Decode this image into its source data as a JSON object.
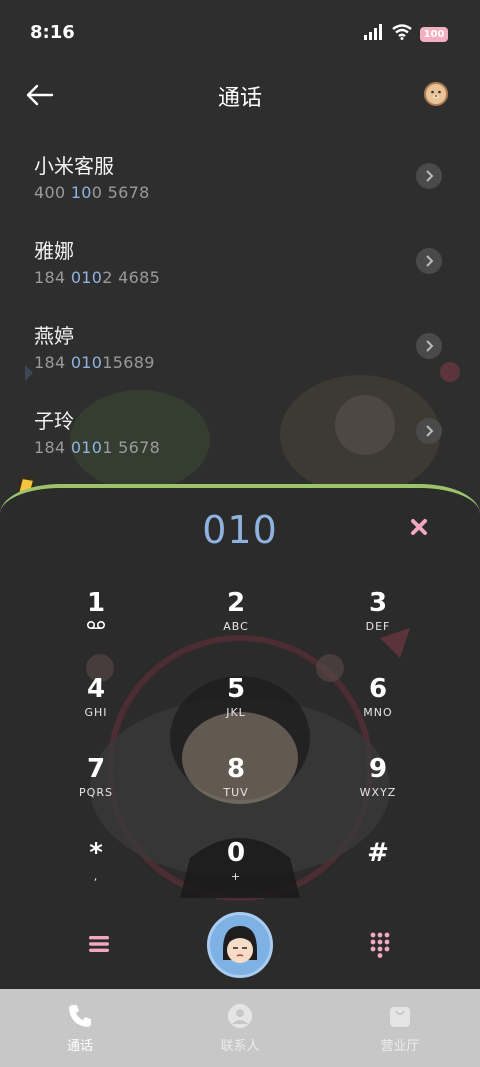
{
  "status": {
    "time": "8:16",
    "battery": "100"
  },
  "header": {
    "title": "通话"
  },
  "contacts": [
    {
      "name": "小米客服",
      "number_pre": "400 ",
      "number_hl": "10",
      "number_mid": "0",
      "number_post": " 5678"
    },
    {
      "name": "雅娜",
      "number_pre": "184 ",
      "number_hl": "010",
      "number_mid": "2",
      "number_post": " 4685"
    },
    {
      "name": "燕婷",
      "number_pre": "184 ",
      "number_hl": "010",
      "number_mid": "1",
      "number_post": "5689"
    },
    {
      "name": "子玲",
      "number_pre": "184 ",
      "number_hl": "010",
      "number_mid": "1",
      "number_post": " 5678"
    }
  ],
  "dialer": {
    "input": "010",
    "keys": [
      {
        "digit": "1",
        "letters": ""
      },
      {
        "digit": "2",
        "letters": "ABC"
      },
      {
        "digit": "3",
        "letters": "DEF"
      },
      {
        "digit": "4",
        "letters": "GHI"
      },
      {
        "digit": "5",
        "letters": "JKL"
      },
      {
        "digit": "6",
        "letters": "MNO"
      },
      {
        "digit": "7",
        "letters": "PQRS"
      },
      {
        "digit": "8",
        "letters": "TUV"
      },
      {
        "digit": "9",
        "letters": "WXYZ"
      },
      {
        "digit": "*",
        "letters": ","
      },
      {
        "digit": "0",
        "letters": "+"
      },
      {
        "digit": "#",
        "letters": ""
      }
    ]
  },
  "tabs": [
    {
      "label": "通话",
      "icon": "phone-icon"
    },
    {
      "label": "联系人",
      "icon": "person-icon"
    },
    {
      "label": "营业厅",
      "icon": "bag-icon"
    }
  ],
  "colors": {
    "accent": "#8fb3e0",
    "pink": "#f2a7c0",
    "panel_border": "#9cc26a"
  }
}
